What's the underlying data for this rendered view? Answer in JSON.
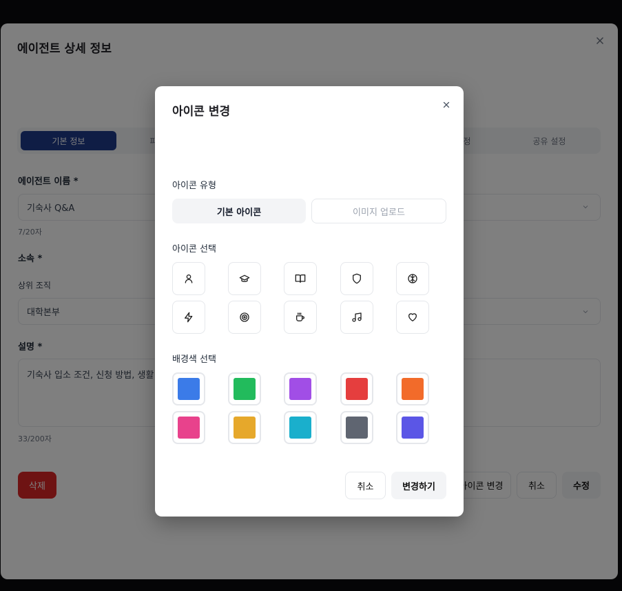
{
  "background": {
    "title": "에이전트 상세 정보",
    "tabs": [
      "기본 정보",
      "",
      "",
      "",
      "공유 설정"
    ],
    "tab_partials": {
      "second": "파",
      "fourth": "정"
    },
    "name_label": "에이전트 이름 *",
    "name_value": "기숙사 Q&A",
    "name_count": "7/20자",
    "affiliation_label": "소속 *",
    "parent_org_label": "상위 조직",
    "parent_org_value": "대학본부",
    "description_label": "설명 *",
    "description_value": "기숙사 입소 조건, 신청 방법, 생활",
    "description_count": "33/200자",
    "delete_label": "삭제",
    "icon_change_label": "아이콘 변경",
    "cancel_label": "취소",
    "edit_label": "수정"
  },
  "modal": {
    "title": "아이콘 변경",
    "icon_type_label": "아이콘 유형",
    "icon_type_options": [
      "기본 아이콘",
      "이미지 업로드"
    ],
    "icon_type_selected": "기본 아이콘",
    "icon_select_label": "아이콘 선택",
    "icons": [
      "user-icon",
      "graduation-cap-icon",
      "book-open-icon",
      "shield-icon",
      "brain-icon",
      "zap-icon",
      "target-icon",
      "coffee-icon",
      "music-icon",
      "heart-icon"
    ],
    "bg_color_label": "배경색 선택",
    "colors": [
      "#3b7be8",
      "#22bb5c",
      "#a14ee6",
      "#e53e3e",
      "#f26b2a",
      "#e8428c",
      "#e6a82b",
      "#1aafcc",
      "#5f6571",
      "#5b56e6"
    ],
    "cancel_label": "취소",
    "confirm_label": "변경하기"
  }
}
